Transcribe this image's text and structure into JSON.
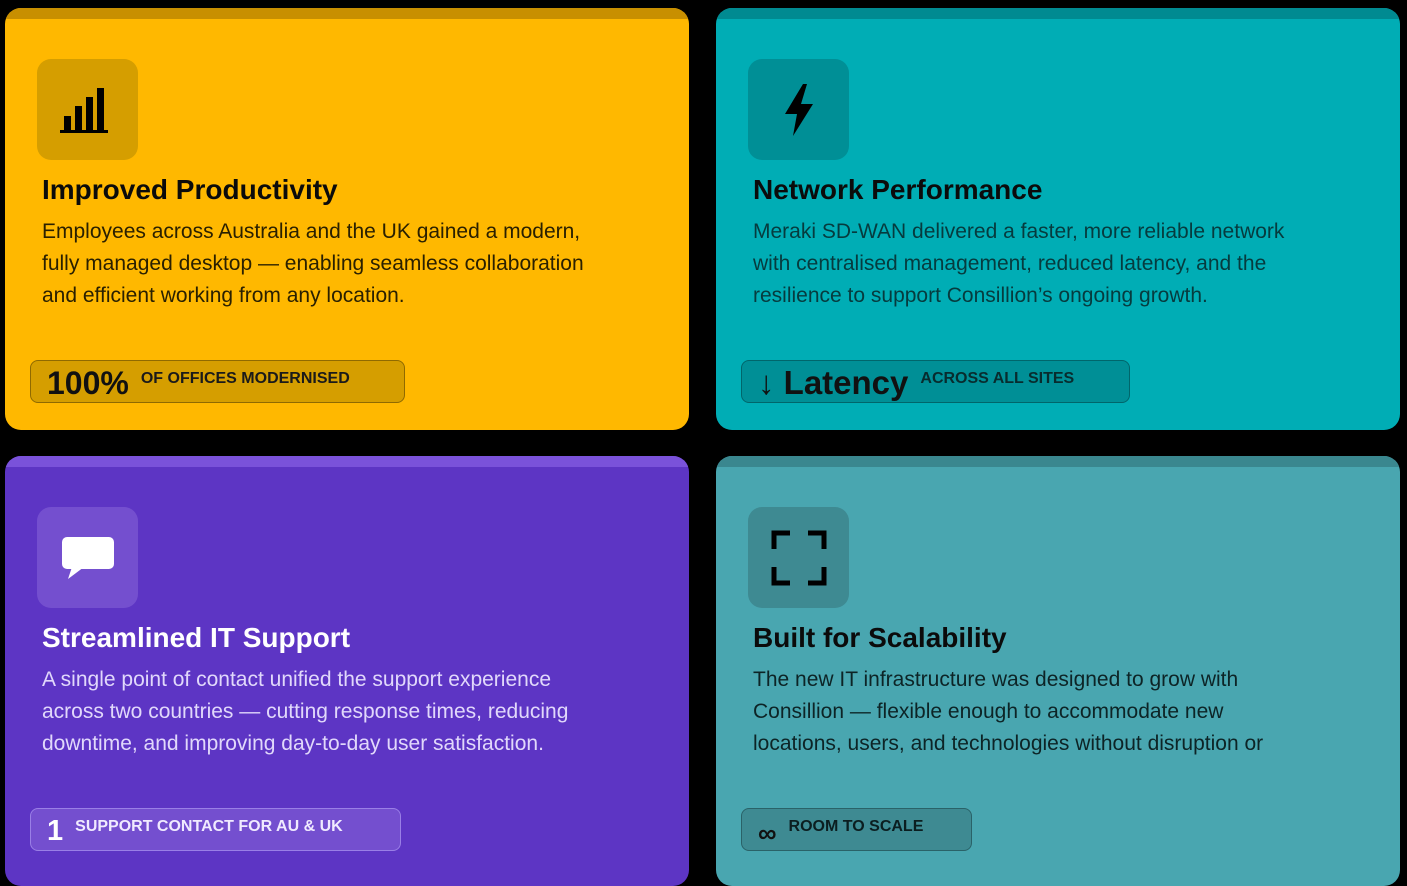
{
  "cards": [
    {
      "icon": "bar-chart-icon",
      "title": "Improved Productivity",
      "text": "Employees across Australia and the UK gained a modern,\nfully managed desktop — enabling seamless collaboration\nand efficient working from any location.",
      "stat_value": "100%",
      "stat_label": "OF OFFICES MODERNISED",
      "color": "#ffb800"
    },
    {
      "icon": "lightning-icon",
      "title": "Network Performance",
      "text": "Meraki SD-WAN delivered a faster, more reliable network\nwith centralised management, reduced latency, and the\nresilience to support Consillion’s ongoing growth.",
      "stat_value": "↓ Latency",
      "stat_label": "ACROSS ALL SITES",
      "color": "#00adb5"
    },
    {
      "icon": "chat-bubble-icon",
      "title": "Streamlined IT Support",
      "text": "A single point of contact unified the support experience\nacross two countries — cutting response times, reducing\ndowntime, and improving day-to-day user satisfaction.",
      "stat_value": "1",
      "stat_label": "SUPPORT CONTACT FOR AU & UK",
      "color": "#5d35c4"
    },
    {
      "icon": "expand-icon",
      "title": "Built for Scalability",
      "text": "The new IT infrastructure was designed to grow with\nConsillion — flexible enough to accommodate new\nlocations, users, and technologies without disruption or",
      "stat_value": "∞",
      "stat_label": "ROOM TO SCALE",
      "color": "#49a6b0"
    }
  ]
}
